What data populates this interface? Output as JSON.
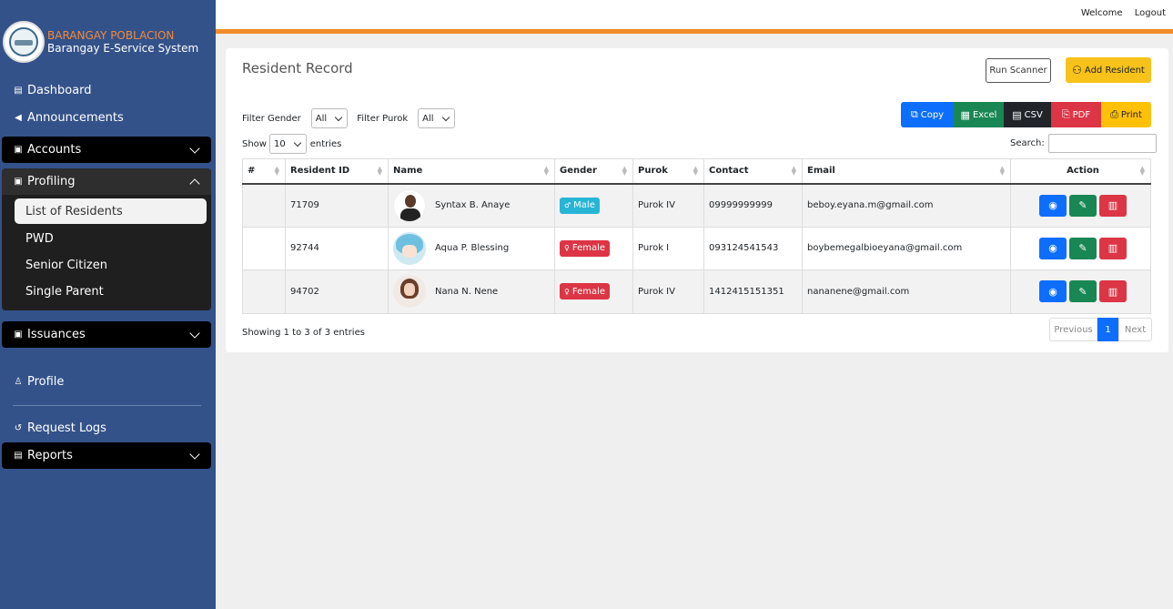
{
  "brand": {
    "line1": "BARANGAY POBLACION",
    "line2": "Barangay E-Service System"
  },
  "topbar": {
    "welcome": "Welcome",
    "logout": "Logout"
  },
  "sidebar": {
    "dashboard": "Dashboard",
    "announcements": "Announcements",
    "accounts": "Accounts",
    "profiling": "Profiling",
    "profiling_items": [
      "List of Residents",
      "PWD",
      "Senior Citizen",
      "Single Parent"
    ],
    "issuances": "Issuances",
    "profile": "Profile",
    "request_logs": "Request Logs",
    "reports": "Reports"
  },
  "page": {
    "title": "Resident Record",
    "run_scanner": "Run Scanner",
    "add_resident": "Add Resident",
    "filter_gender_label": "Filter Gender",
    "filter_gender_value": "All",
    "filter_purok_label": "Filter Purok",
    "filter_purok_value": "All",
    "show_label": "Show",
    "show_value": "10",
    "entries_label": "entries",
    "search_label": "Search:",
    "showing": "Showing 1 to 3 of 3 entries",
    "pager": {
      "prev": "Previous",
      "current": "1",
      "next": "Next"
    }
  },
  "export": {
    "copy": "Copy",
    "excel": "Excel",
    "csv": "CSV",
    "pdf": "PDF",
    "print": "Print"
  },
  "table": {
    "headers": [
      "#",
      "Resident ID",
      "Name",
      "Gender",
      "Purok",
      "Contact",
      "Email",
      "Action"
    ],
    "rows": [
      {
        "num": "",
        "id": "71709",
        "name": "Syntax B. Anaye",
        "gender": "Male",
        "purok": "Purok IV",
        "contact": "09999999999",
        "email": "beboy.eyana.m@gmail.com"
      },
      {
        "num": "",
        "id": "92744",
        "name": "Aqua P. Blessing",
        "gender": "Female",
        "purok": "Purok I",
        "contact": "093124541543",
        "email": "boybemegalbioeyana@gmail.com"
      },
      {
        "num": "",
        "id": "94702",
        "name": "Nana N. Nene",
        "gender": "Female",
        "purok": "Purok IV",
        "contact": "1412415151351",
        "email": "nananene@gmail.com"
      }
    ]
  },
  "colors": {
    "sidebar": "#34528a",
    "accent": "#f28c28",
    "male": "#27b5d6",
    "female": "#dc3545",
    "view": "#0d6efd",
    "edit": "#198754",
    "delete": "#dc3545"
  }
}
